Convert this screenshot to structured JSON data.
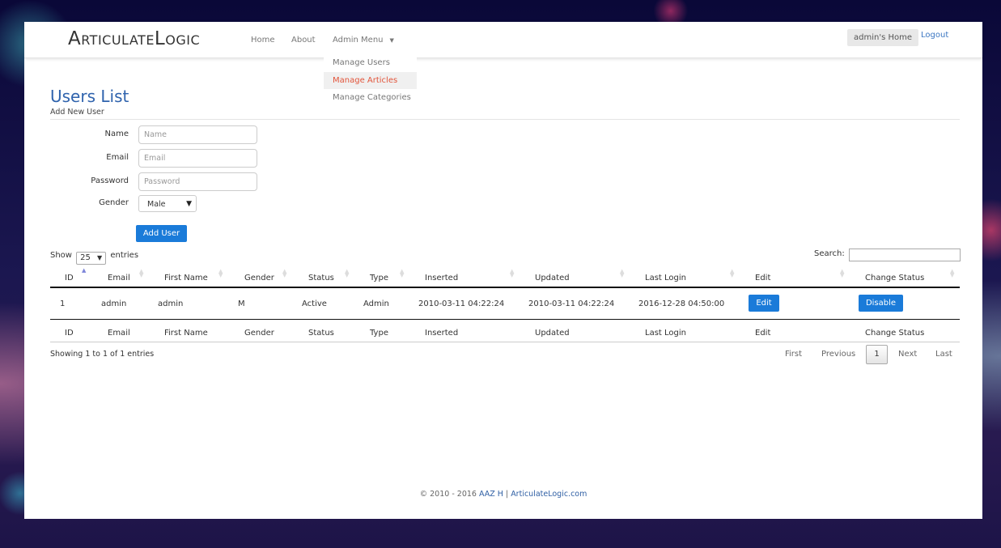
{
  "navbar": {
    "brand": "ArticulateLogic",
    "links": [
      "Home",
      "About"
    ],
    "admin_menu": {
      "label": "Admin Menu",
      "items": [
        {
          "label": "Manage Users",
          "active": false
        },
        {
          "label": "Manage Articles",
          "active": true
        },
        {
          "label": "Manage Categories",
          "active": false
        }
      ]
    },
    "home_button": "admin's Home",
    "logout": "Logout"
  },
  "page": {
    "title": "Users List",
    "subtitle": "Add New User"
  },
  "form": {
    "name_label": "Name",
    "name_placeholder": "Name",
    "email_label": "Email",
    "email_placeholder": "Email",
    "password_label": "Password",
    "password_placeholder": "Password",
    "gender_label": "Gender",
    "gender_value": "Male",
    "submit": "Add User"
  },
  "table_controls": {
    "show_prefix": "Show",
    "page_length": "25",
    "show_suffix": "entries",
    "search_label": "Search:",
    "search_value": ""
  },
  "table": {
    "columns": [
      "ID",
      "Email",
      "First Name",
      "Gender",
      "Status",
      "Type",
      "Inserted",
      "Updated",
      "Last Login",
      "Edit",
      "Change Status"
    ],
    "sorted_column": "ID",
    "rows": [
      {
        "id": "1",
        "email": "admin",
        "first_name": "admin",
        "gender": "M",
        "status": "Active",
        "type": "Admin",
        "inserted": "2010-03-11 04:22:24",
        "updated": "2010-03-11 04:22:24",
        "last_login": "2016-12-28 04:50:00",
        "edit": "Edit",
        "change_status": "Disable"
      }
    ]
  },
  "pagination": {
    "info": "Showing 1 to 1 of 1 entries",
    "first": "First",
    "previous": "Previous",
    "current": "1",
    "next": "Next",
    "last": "Last"
  },
  "footer": {
    "copyright": "© 2010 - 2016",
    "author": "AAZ H",
    "separator": "|",
    "site": "ArticulateLogic.com"
  }
}
